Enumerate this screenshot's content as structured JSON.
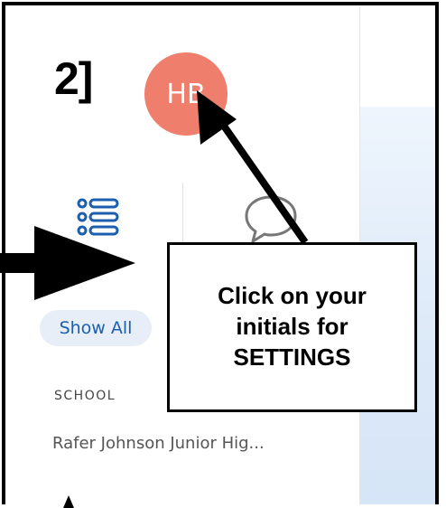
{
  "step": {
    "label": "2]"
  },
  "user": {
    "initials": "HB",
    "avatar_color": "#ef7e6c"
  },
  "tabs": [
    {
      "name": "list",
      "icon": "list-icon"
    },
    {
      "name": "chat",
      "icon": "chat-bubble-icon"
    }
  ],
  "filter": {
    "show_all_label": "Show All"
  },
  "school": {
    "heading": "SCHOOL",
    "name": "Rafer Johnson Junior Hig..."
  },
  "callout": {
    "lines": [
      "Click on your",
      "initials for",
      "SETTINGS"
    ]
  },
  "colors": {
    "accent": "#1c5fae",
    "pill_bg": "#e7eef7",
    "panel_blue": "#dce9f8"
  }
}
